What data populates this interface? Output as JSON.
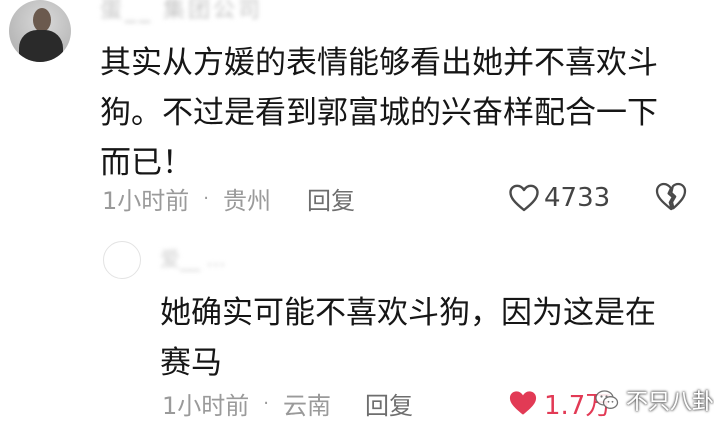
{
  "comments": [
    {
      "username": "蛋__ 集团公司",
      "text": "其实从方媛的表情能够看出她并不喜欢斗狗。不过是看到郭富城的兴奋样配合一下而已！",
      "time": "1小时前",
      "separator": "·",
      "location": "贵州",
      "reply_label": "回复",
      "likes": "4733",
      "liked": false,
      "icons": {
        "like": "heart-outline-icon",
        "dislike": "broken-heart-icon"
      }
    },
    {
      "username": "爱__ ...",
      "text": "她确实可能不喜欢斗狗，因为这是在赛马",
      "time": "1小时前",
      "separator": "·",
      "location": "云南",
      "reply_label": "回复",
      "likes": "1.7万",
      "liked": true,
      "icons": {
        "like": "heart-filled-icon"
      }
    }
  ],
  "watermark": {
    "text": "不只八卦",
    "icon": "wechat-icon"
  },
  "colors": {
    "like_active": "#e23a55",
    "meta_text": "#9a9a9a",
    "body_text": "#161616"
  }
}
